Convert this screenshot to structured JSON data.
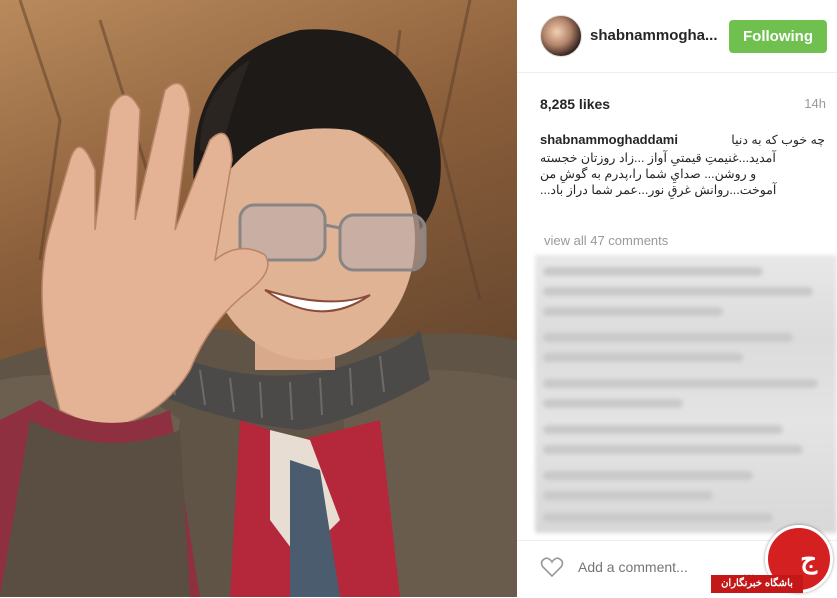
{
  "post": {
    "photo_alt": "",
    "username": "shabnammogha...",
    "follow_label": "Following",
    "likes": "8,285 likes",
    "time_ago": "14h",
    "caption": {
      "username": "shabnammoghaddami",
      "line1": "چه خوب که به دنیا",
      "rest": "آمدید...غنیمتِ قیمتیِ آواز ...زاد روزتان خجسته و روشن... صدايِ شما را،پدرم به گوشِ من آموخت...روانش غرقِ نور...عمر شما دراز باد..."
    },
    "view_all_comments": "view all 47 comments",
    "add_comment_placeholder": "Add a comment...",
    "more_label": "..."
  },
  "watermark": {
    "text": "باشگاه خبرنگاران"
  },
  "colors": {
    "follow_green": "#70c050",
    "watermark_red": "#d42020"
  }
}
